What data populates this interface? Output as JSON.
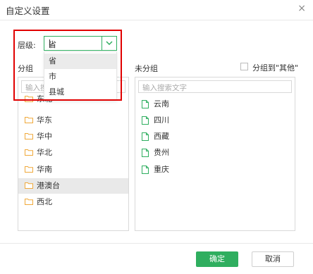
{
  "dialog": {
    "title": "自定义设置",
    "close_glyph": "×"
  },
  "level": {
    "label": "层级:",
    "value": "省",
    "options": [
      "省",
      "市",
      "县城"
    ]
  },
  "left_panel": {
    "header": "分组",
    "search_placeholder": "输入搜",
    "items": [
      "东北",
      "华东",
      "华中",
      "华北",
      "华南",
      "港澳台",
      "西北"
    ],
    "active_index": 5
  },
  "right_panel": {
    "header": "未分组",
    "checkbox_label": "分组到\"其他\"",
    "search_placeholder": "输入搜索文字",
    "items": [
      "云南",
      "四川",
      "西藏",
      "贵州",
      "重庆"
    ]
  },
  "footer": {
    "ok_label": "确定",
    "cancel_label": "取消"
  },
  "colors": {
    "accent": "#2fae5f",
    "folder": "#f0a93b",
    "file": "#2fae5f",
    "highlight": "#e10000"
  }
}
